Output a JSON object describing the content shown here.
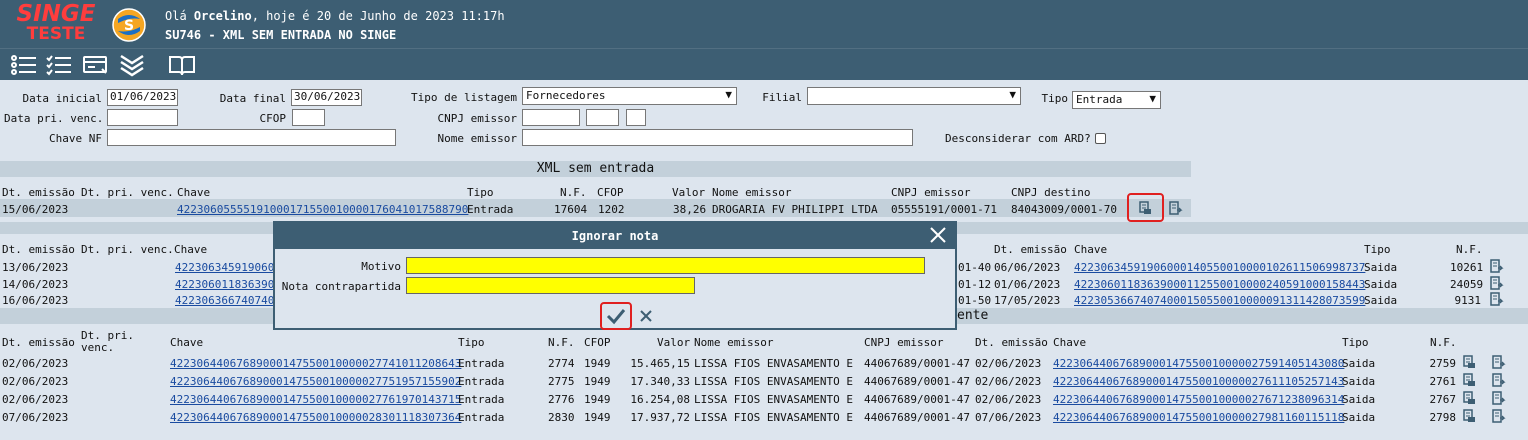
{
  "header": {
    "logo_line1": "SINGE",
    "logo_line2": "TESTE",
    "greeting_prefix": "Olá ",
    "user": "Orcelino",
    "greeting_suffix": ", hoje é 20 de Junho de 2023 11:17h",
    "title": "SU746 - XML SEM ENTRADA NO SINGE"
  },
  "filters": {
    "data_inicial_label": "Data inicial",
    "data_inicial": "01/06/2023",
    "data_final_label": "Data final",
    "data_final": "30/06/2023",
    "tipo_listagem_label": "Tipo de listagem",
    "tipo_listagem": "Fornecedores",
    "filial_label": "Filial",
    "filial": "",
    "tipo_label": "Tipo",
    "tipo": "Entrada",
    "data_pri_venc_label": "Data pri. venc.",
    "data_pri_venc": "",
    "cfop_label": "CFOP",
    "cfop": "",
    "cnpj_emissor_label": "CNPJ emissor",
    "chave_nf_label": "Chave NF",
    "chave_nf": "",
    "nome_emissor_label": "Nome emissor",
    "nome_emissor": "",
    "desconsiderar_label": "Desconsiderar com ARD?"
  },
  "section1": {
    "title": "XML sem entrada",
    "headers": [
      "Dt. emissão",
      "Dt. pri. venc.",
      "Chave",
      "Tipo",
      "N.F.",
      "CFOP",
      "Valor",
      "Nome emissor",
      "CNPJ emissor",
      "CNPJ destino"
    ],
    "rows": [
      {
        "dt": "15/06/2023",
        "venc": "",
        "chave": "42230605555191000171550010000176041017588790",
        "tipo": "Entrada",
        "nf": "17604",
        "cfop": "1202",
        "valor": "38,26",
        "nome": "DROGARIA FV PHILIPPI LTDA",
        "cnpj_em": "05555191/0001-71",
        "cnpj_dest": "84043009/0001-70"
      }
    ]
  },
  "section2": {
    "headers_left": [
      "Dt. emissão",
      "Dt. pri. venc.",
      "Chave"
    ],
    "headers_right": [
      "Dt. emissão",
      "Chave",
      "Tipo",
      "N.F."
    ],
    "rows": [
      {
        "dt": "13/06/2023",
        "chave": "4223063459190600",
        "cnpj_tail": "01-40",
        "dt2": "06/06/2023",
        "chave2": "42230634591906000140550010000102611506998737",
        "tipo2": "Saida",
        "nf2": "10261"
      },
      {
        "dt": "14/06/2023",
        "chave": "4223060118363900",
        "cnpj_tail": "01-12",
        "dt2": "01/06/2023",
        "chave2": "42230601183639000112550010000240591000158443",
        "tipo2": "Saida",
        "nf2": "24059"
      },
      {
        "dt": "16/06/2023",
        "chave": "4223063667407400",
        "cnpj_tail": "01-50",
        "dt2": "17/05/2023",
        "chave2": "42230536674074000150550010000091311428073599",
        "tipo2": "Saida",
        "nf2": "9131"
      }
    ]
  },
  "section3": {
    "title_tail": "ente",
    "headers": [
      "Dt. emissão",
      "Dt. pri. venc.",
      "Chave",
      "Tipo",
      "N.F.",
      "CFOP",
      "Valor",
      "Nome emissor",
      "CNPJ emissor",
      "Dt. emissão",
      "Chave",
      "Tipo",
      "N.F."
    ],
    "rows": [
      {
        "dt": "02/06/2023",
        "chave": "42230644067689000147550010000027741011208643",
        "tipo": "Entrada",
        "nf": "2774",
        "cfop": "1949",
        "valor": "15.465,15",
        "nome": "LISSA FIOS ENVASAMENTO E",
        "cnpj": "44067689/0001-47",
        "dt2": "02/06/2023",
        "chave2": "42230644067689000147550010000027591405143080",
        "tipo2": "Saida",
        "nf2": "2759"
      },
      {
        "dt": "02/06/2023",
        "chave": "42230644067689000147550010000027751957155902",
        "tipo": "Entrada",
        "nf": "2775",
        "cfop": "1949",
        "valor": "17.340,33",
        "nome": "LISSA FIOS ENVASAMENTO E",
        "cnpj": "44067689/0001-47",
        "dt2": "02/06/2023",
        "chave2": "42230644067689000147550010000027611105257143",
        "tipo2": "Saida",
        "nf2": "2761"
      },
      {
        "dt": "02/06/2023",
        "chave": "42230644067689000147550010000027761970143715",
        "tipo": "Entrada",
        "nf": "2776",
        "cfop": "1949",
        "valor": "16.254,08",
        "nome": "LISSA FIOS ENVASAMENTO E",
        "cnpj": "44067689/0001-47",
        "dt2": "02/06/2023",
        "chave2": "42230644067689000147550010000027671238096314",
        "tipo2": "Saida",
        "nf2": "2767"
      },
      {
        "dt": "07/06/2023",
        "chave": "42230644067689000147550010000028301118307364",
        "tipo": "Entrada",
        "nf": "2830",
        "cfop": "1949",
        "valor": "17.937,72",
        "nome": "LISSA FIOS ENVASAMENTO E",
        "cnpj": "44067689/0001-47",
        "dt2": "07/06/2023",
        "chave2": "42230644067689000147550010000027981160115118",
        "tipo2": "Saida",
        "nf2": "2798"
      }
    ]
  },
  "modal": {
    "title": "Ignorar nota",
    "motivo_label": "Motivo",
    "motivo": "",
    "contrapartida_label": "Nota contrapartida",
    "contrapartida": ""
  },
  "colors": {
    "header_bg": "#3d5e73",
    "page_bg": "#dde5ee",
    "section_bg": "#c3d0da",
    "link": "#1a4ba0",
    "highlight_box": "#e02020",
    "required_field": "#ffff00",
    "logo_red": "#ff3d3d"
  }
}
